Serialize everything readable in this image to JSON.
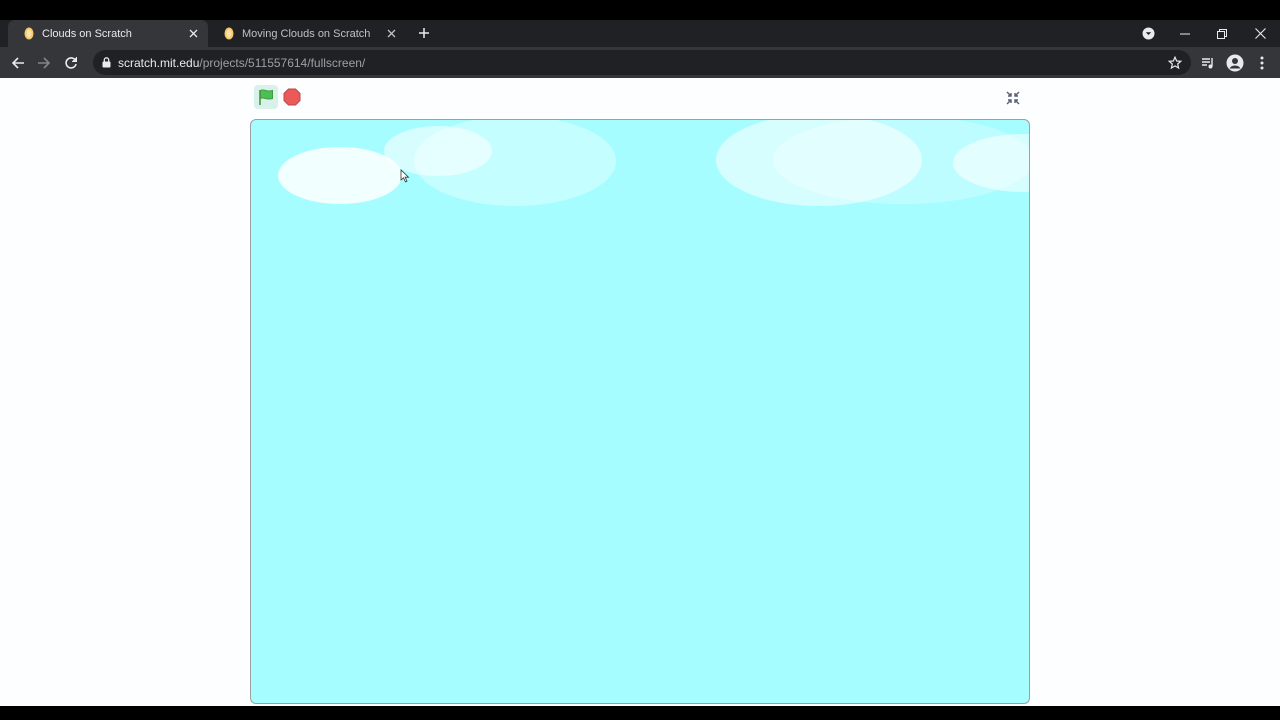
{
  "browser": {
    "tabs": [
      {
        "title": "Clouds on Scratch",
        "active": true
      },
      {
        "title": "Moving Clouds on Scratch",
        "active": false
      }
    ],
    "url_host": "scratch.mit.edu",
    "url_path": "/projects/511557614/fullscreen/",
    "icons": {
      "back": "arrow-left-icon",
      "forward": "arrow-right-icon",
      "reload": "reload-icon",
      "lock": "lock-icon",
      "bookmark": "star-icon",
      "media": "media-queue-icon",
      "profile": "profile-icon",
      "menu": "kebab-menu-icon",
      "new_tab": "plus-icon",
      "tab_search": "chevron-down-icon"
    }
  },
  "stage": {
    "background_color": "#a6fdff",
    "cloud_color": "#ffffff",
    "controls": {
      "green_flag": "green-flag-icon",
      "stop": "stop-icon",
      "unfullscreen": "unfullscreen-icon"
    },
    "flag_color": "#4cbf56",
    "stop_color": "#ec5959"
  }
}
